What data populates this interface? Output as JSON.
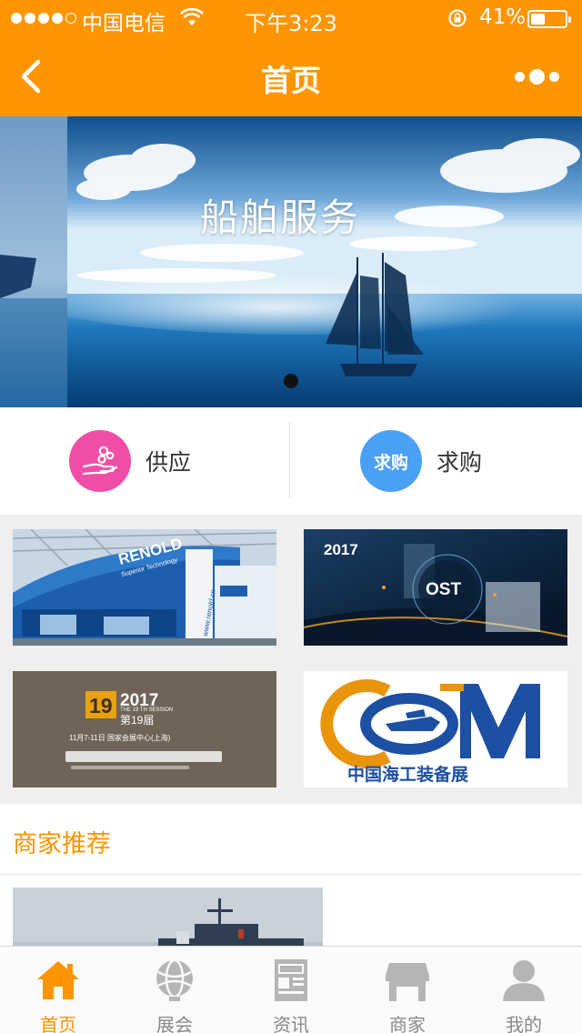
{
  "status_bar": {
    "carrier": "中国电信",
    "time": "下午3:23",
    "battery_percent": "41%",
    "battery_level": 0.41,
    "signal_filled": 4,
    "signal_total": 5
  },
  "nav": {
    "title": "首页",
    "back_icon": "chevron-left-icon",
    "more_icon": "more-dots-icon"
  },
  "banner": {
    "caption": "船舶服务",
    "slide_count": 1,
    "active_slide": 0
  },
  "quick_links": [
    {
      "label": "供应",
      "icon": "supply-hand-icon",
      "color": "#f04ea6"
    },
    {
      "label": "求购",
      "icon_text": "求购",
      "color": "#4aa0f5"
    }
  ],
  "exhibitions": {
    "renold": {
      "logo": "RENOLD",
      "tagline": "Superior Technology",
      "url": "www.renold.cn"
    },
    "ost": {
      "year": "2017",
      "name": "OST"
    },
    "ciif": {
      "num": "19",
      "year": "2017",
      "session": "THE 19 TH SESSION",
      "edition": "第19届",
      "dates": "11月7-11日  国家会展中心(上海)"
    },
    "com": {
      "logo": "COM",
      "name": "中国海工装备展"
    }
  },
  "recommend": {
    "title": "商家推荐"
  },
  "tabs": [
    {
      "label": "首页",
      "icon": "home-icon",
      "active": true
    },
    {
      "label": "展会",
      "icon": "globe-icon",
      "active": false
    },
    {
      "label": "资讯",
      "icon": "news-icon",
      "active": false
    },
    {
      "label": "商家",
      "icon": "store-icon",
      "active": false
    },
    {
      "label": "我的",
      "icon": "user-icon",
      "active": false
    }
  ],
  "colors": {
    "brand": "#ff9500",
    "active_tab": "#ff9500",
    "inactive_tab": "#888888"
  }
}
